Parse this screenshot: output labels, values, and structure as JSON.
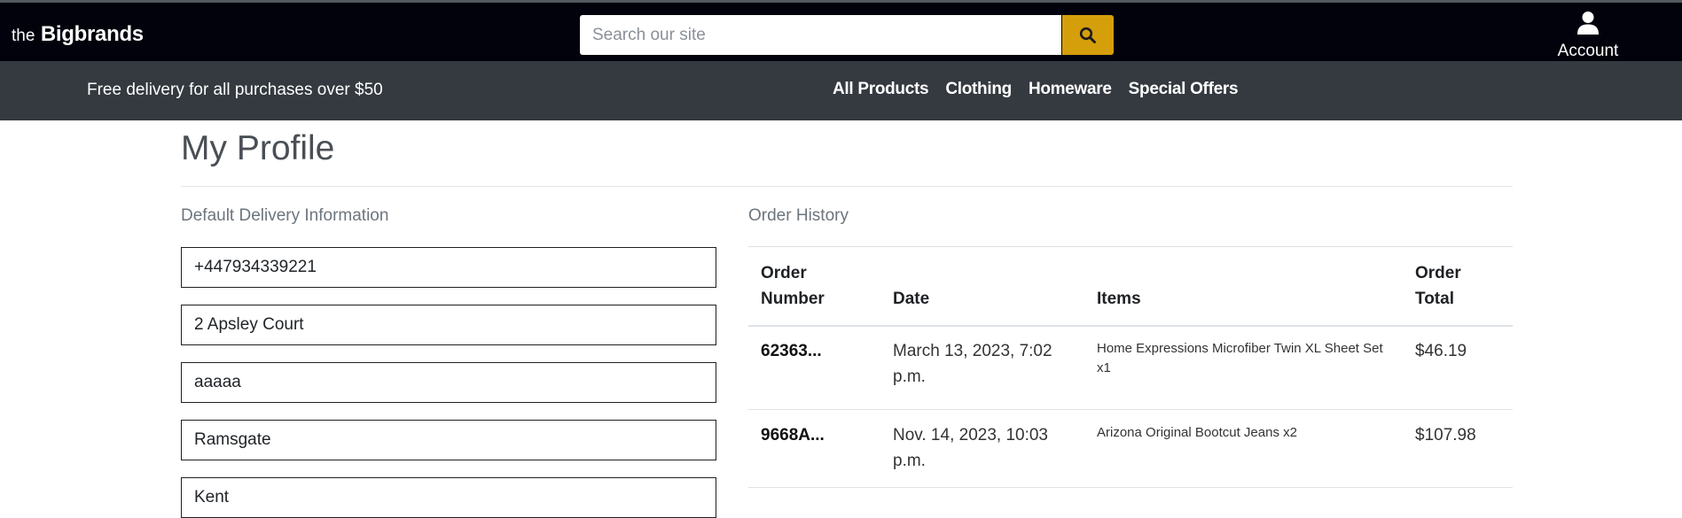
{
  "header": {
    "brand_prefix": "the",
    "brand_name": "Bigbrands",
    "search_placeholder": "Search our site",
    "account_label": "Account"
  },
  "nav": {
    "banner": "Free delivery for all purchases over $50",
    "links": [
      "All Products",
      "Clothing",
      "Homeware",
      "Special Offers"
    ]
  },
  "profile": {
    "title": "My Profile",
    "delivery_heading": "Default Delivery Information",
    "fields": [
      "+447934339221",
      "2 Apsley Court",
      "aaaaa",
      "Ramsgate",
      "Kent"
    ],
    "orders_heading": "Order History",
    "columns": [
      "Order Number",
      "Date",
      "Items",
      "Order Total"
    ],
    "orders": [
      {
        "number": "62363...",
        "date": "March 13, 2023, 7:02 p.m.",
        "items": "Home Expressions Microfiber Twin XL Sheet Set x1",
        "total": "$46.19"
      },
      {
        "number": "9668A...",
        "date": "Nov. 14, 2023, 10:03 p.m.",
        "items": "Arizona Original Bootcut Jeans x2",
        "total": "$107.98"
      }
    ]
  },
  "colors": {
    "header_bg": "#01020c",
    "nav_bg": "#343a40",
    "accent": "#d59e0b"
  }
}
